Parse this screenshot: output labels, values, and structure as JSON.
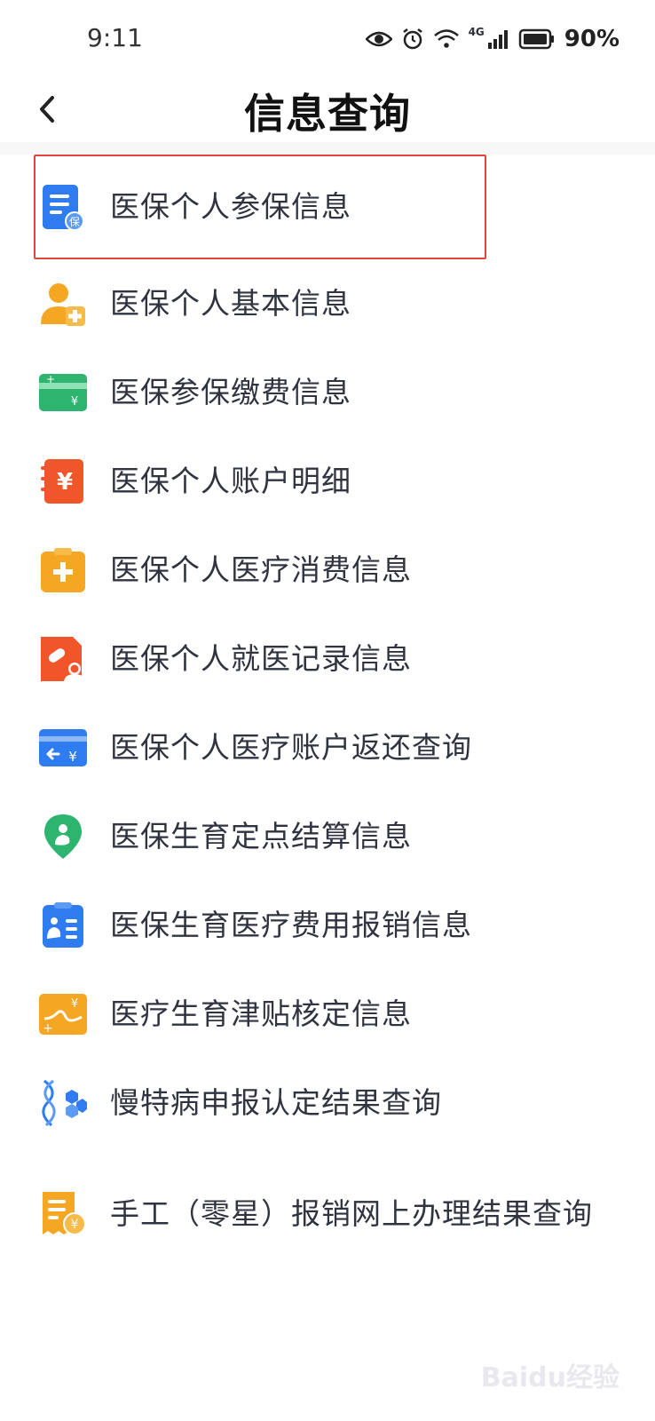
{
  "status": {
    "time": "9:11",
    "network": "4G",
    "battery": "90%"
  },
  "header": {
    "title": "信息查询"
  },
  "items": [
    {
      "label": "医保个人参保信息",
      "icon": "insurance-doc-icon"
    },
    {
      "label": "医保个人基本信息",
      "icon": "user-plus-icon"
    },
    {
      "label": "医保参保缴费信息",
      "icon": "payment-card-icon"
    },
    {
      "label": "医保个人账户明细",
      "icon": "yuan-ledger-icon"
    },
    {
      "label": "医保个人医疗消费信息",
      "icon": "medical-kit-icon"
    },
    {
      "label": "医保个人就医记录信息",
      "icon": "medical-record-icon"
    },
    {
      "label": "医保个人医疗账户返还查询",
      "icon": "refund-card-icon"
    },
    {
      "label": "医保生育定点结算信息",
      "icon": "maternity-location-icon"
    },
    {
      "label": "医保生育医疗费用报销信息",
      "icon": "maternity-clipboard-icon"
    },
    {
      "label": "医疗生育津贴核定信息",
      "icon": "allowance-chart-icon"
    },
    {
      "label": "慢特病申报认定结果查询",
      "icon": "dna-icon"
    },
    {
      "label": "手工（零星）报销网上办理结果查询",
      "icon": "receipt-yuan-icon"
    }
  ],
  "watermark": "Baidu经验",
  "colors": {
    "blue": "#2f7bf0",
    "orange": "#f5a623",
    "red_orange": "#f0562a",
    "green": "#2db56f",
    "highlight": "#e2453c"
  }
}
